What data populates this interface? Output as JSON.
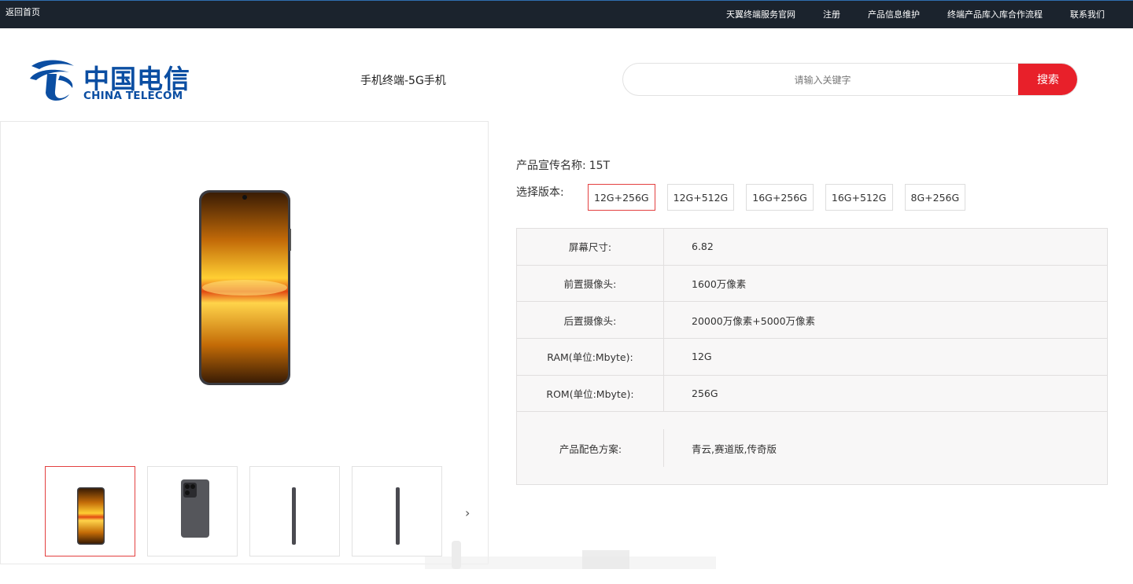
{
  "topbar": {
    "home_label": "返回首页",
    "nav": [
      "天翼终端服务官网",
      "注册",
      "产品信息维护",
      "终端产品库入库合作流程",
      "联系我们"
    ]
  },
  "header": {
    "logo_cn": "中国电信",
    "logo_en": "CHINA TELECOM",
    "category": "手机终端-5G手机",
    "search_placeholder": "请输入关键字",
    "search_button": "搜索"
  },
  "product": {
    "name_label": "产品宣传名称:",
    "name_value": "15T",
    "version_label": "选择版本:",
    "versions": [
      "12G+256G",
      "12G+512G",
      "16G+256G",
      "16G+512G",
      "8G+256G"
    ],
    "selected_version": "12G+256G",
    "specs": [
      {
        "key": "屏幕尺寸:",
        "value": "6.82"
      },
      {
        "key": "前置摄像头:",
        "value": "1600万像素"
      },
      {
        "key": "后置摄像头:",
        "value": "20000万像素+5000万像素"
      },
      {
        "key": "RAM(单位:Mbyte):",
        "value": "12G"
      },
      {
        "key": "ROM(单位:Mbyte):",
        "value": "256G"
      },
      {
        "key": "产品配色方案:",
        "value": "青云,赛道版,传奇版"
      }
    ]
  },
  "gallery": {
    "thumbnails": [
      "phone-front",
      "phone-back",
      "phone-side",
      "phone-side"
    ],
    "active_index": 0,
    "next_icon": "chevron-right-icon"
  },
  "colors": {
    "topbar_bg": "#1b232d",
    "accent_red": "#e8202a",
    "brand_blue": "#0b4ea2"
  }
}
